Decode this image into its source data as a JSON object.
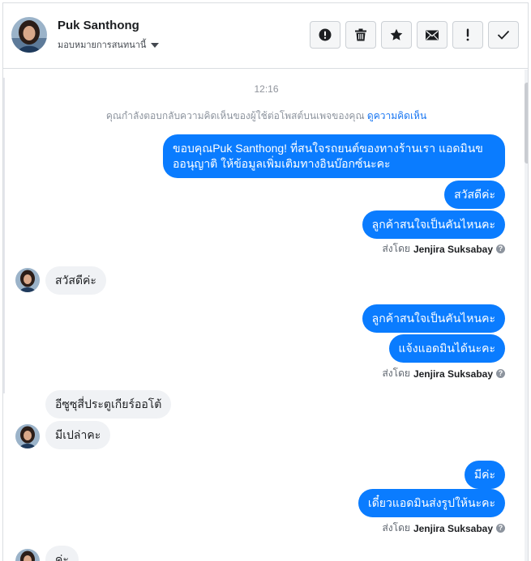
{
  "header": {
    "contact_name": "Puk Santhong",
    "assign_label": "มอบหมายการสนทนานี้",
    "actions": [
      {
        "name": "report-spam-button",
        "icon": "alert-circle-icon"
      },
      {
        "name": "delete-button",
        "icon": "trash-icon"
      },
      {
        "name": "star-button",
        "icon": "star-icon"
      },
      {
        "name": "mark-unread-button",
        "icon": "envelope-icon"
      },
      {
        "name": "follow-up-button",
        "icon": "exclamation-icon"
      },
      {
        "name": "mark-done-button",
        "icon": "checkmark-icon"
      }
    ]
  },
  "chat": {
    "timestamp": "12:16",
    "notice_text": "คุณกำลังตอบกลับความคิดเห็นของผู้ใช้ต่อโพสต์บนเพจของคุณ",
    "notice_link": "ดูความคิดเห็น",
    "messages": [
      {
        "dir": "out",
        "text": "ขอบคุณPuk Santhong! ที่สนใจรถยนต์ของทางร้านเรา แอดมินขออนุญาติ ให้ข้อมูลเพิ่มเติมทางอินบ๊อกซ์นะคะ"
      },
      {
        "dir": "out",
        "text": "สวัสดีค่ะ"
      },
      {
        "dir": "out",
        "text": "ลูกค้าสนใจเป็นคันไหนคะ"
      },
      {
        "dir": "in",
        "text": "สวัสดีค่ะ"
      },
      {
        "dir": "out",
        "text": "ลูกค้าสนใจเป็นคันไหนคะ"
      },
      {
        "dir": "out",
        "text": "แจ้งแอดมินได้นะคะ"
      },
      {
        "dir": "in",
        "text": "อีซูซุสี่ประตูเกียร์ออโต้"
      },
      {
        "dir": "in",
        "text": "มีเปล่าคะ"
      },
      {
        "dir": "out",
        "text": "มีค่ะ"
      },
      {
        "dir": "out",
        "text": "เดี๋ยวแอดมินส่งรูปให้นะคะ"
      }
    ],
    "sent_by_prefix": "ส่งโดย",
    "sent_by_name": "Jenjira Suksabay",
    "partial_bubble_text": "ค่ะ"
  },
  "colors": {
    "outgoing_bubble": "#0a7cff",
    "incoming_bubble": "#f0f2f5",
    "link": "#1876f2"
  }
}
